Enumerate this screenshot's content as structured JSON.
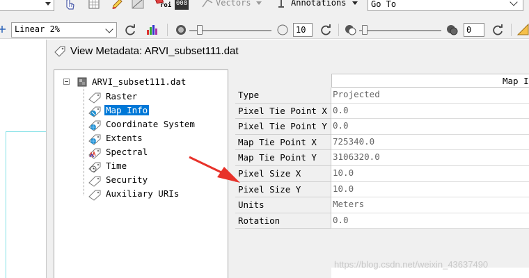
{
  "toolbar": {
    "vectors_label": "Vectors",
    "annotations_label": "Annotations",
    "goto_label": "Go To",
    "stretch_value": "Linear 2%",
    "brightness_value": "10",
    "transparency_value": "0",
    "roi_label": "roi",
    "num_label": "008"
  },
  "dialog": {
    "title": "View Metadata: ARVI_subset111.dat",
    "table_header": "Map In"
  },
  "tree": {
    "root": "ARVI_subset111.dat",
    "items": [
      {
        "label": "Raster"
      },
      {
        "label": "Map Info"
      },
      {
        "label": "Coordinate System"
      },
      {
        "label": "Extents"
      },
      {
        "label": "Spectral"
      },
      {
        "label": "Time"
      },
      {
        "label": "Security"
      },
      {
        "label": "Auxiliary URIs"
      }
    ]
  },
  "table": {
    "rows": [
      {
        "key": "Type",
        "value": "Projected"
      },
      {
        "key": "Pixel Tie Point X",
        "value": "0.0"
      },
      {
        "key": "Pixel Tie Point Y",
        "value": "0.0"
      },
      {
        "key": "Map Tie Point X",
        "value": "725340.0"
      },
      {
        "key": "Map Tie Point Y",
        "value": "3106320.0"
      },
      {
        "key": "Pixel Size X",
        "value": "10.0"
      },
      {
        "key": "Pixel Size Y",
        "value": "10.0"
      },
      {
        "key": "Units",
        "value": "Meters"
      },
      {
        "key": "Rotation",
        "value": "0.0"
      }
    ]
  },
  "watermark": "https://blog.csdn.net/weixin_43637490",
  "colors": {
    "selection": "#0078d7",
    "arrow": "#e8322a"
  }
}
